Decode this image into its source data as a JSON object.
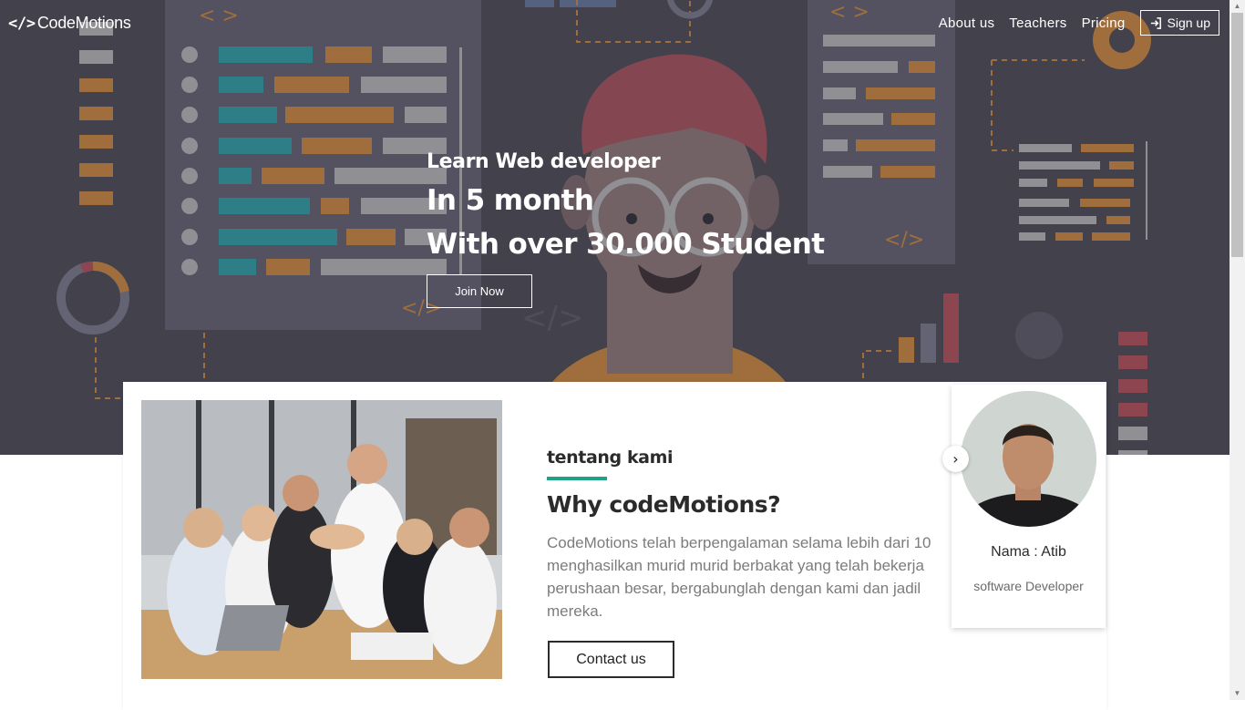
{
  "nav": {
    "logo_mark": "</>",
    "logo_text": "CodeMotions",
    "links": [
      "About us",
      "Teachers",
      "Pricing"
    ],
    "signup_label": "Sign up"
  },
  "hero": {
    "line1": "Learn Web developer",
    "line2": "In 5 month",
    "line3": "With over 30.000 Student",
    "join_label": "Join Now"
  },
  "about": {
    "label": "tentang kami",
    "title": "Why codeMotions?",
    "text": "CodeMotions telah berpengalaman selama lebih dari 10\nmenghasilkan murid murid berbakat yang telah bekerja\nperushaan besar, bergabunglah dengan kami dan jadil\nmereka.",
    "contact_label": "Contact us"
  },
  "teacher": {
    "name": "Nama : Atib",
    "role": "software Developer",
    "next_icon": "chevron-right-icon"
  },
  "colors": {
    "hero_bg": "#47454f",
    "accent": "#1fa385",
    "teal": "#2f8a93",
    "orange": "#b0783e"
  }
}
